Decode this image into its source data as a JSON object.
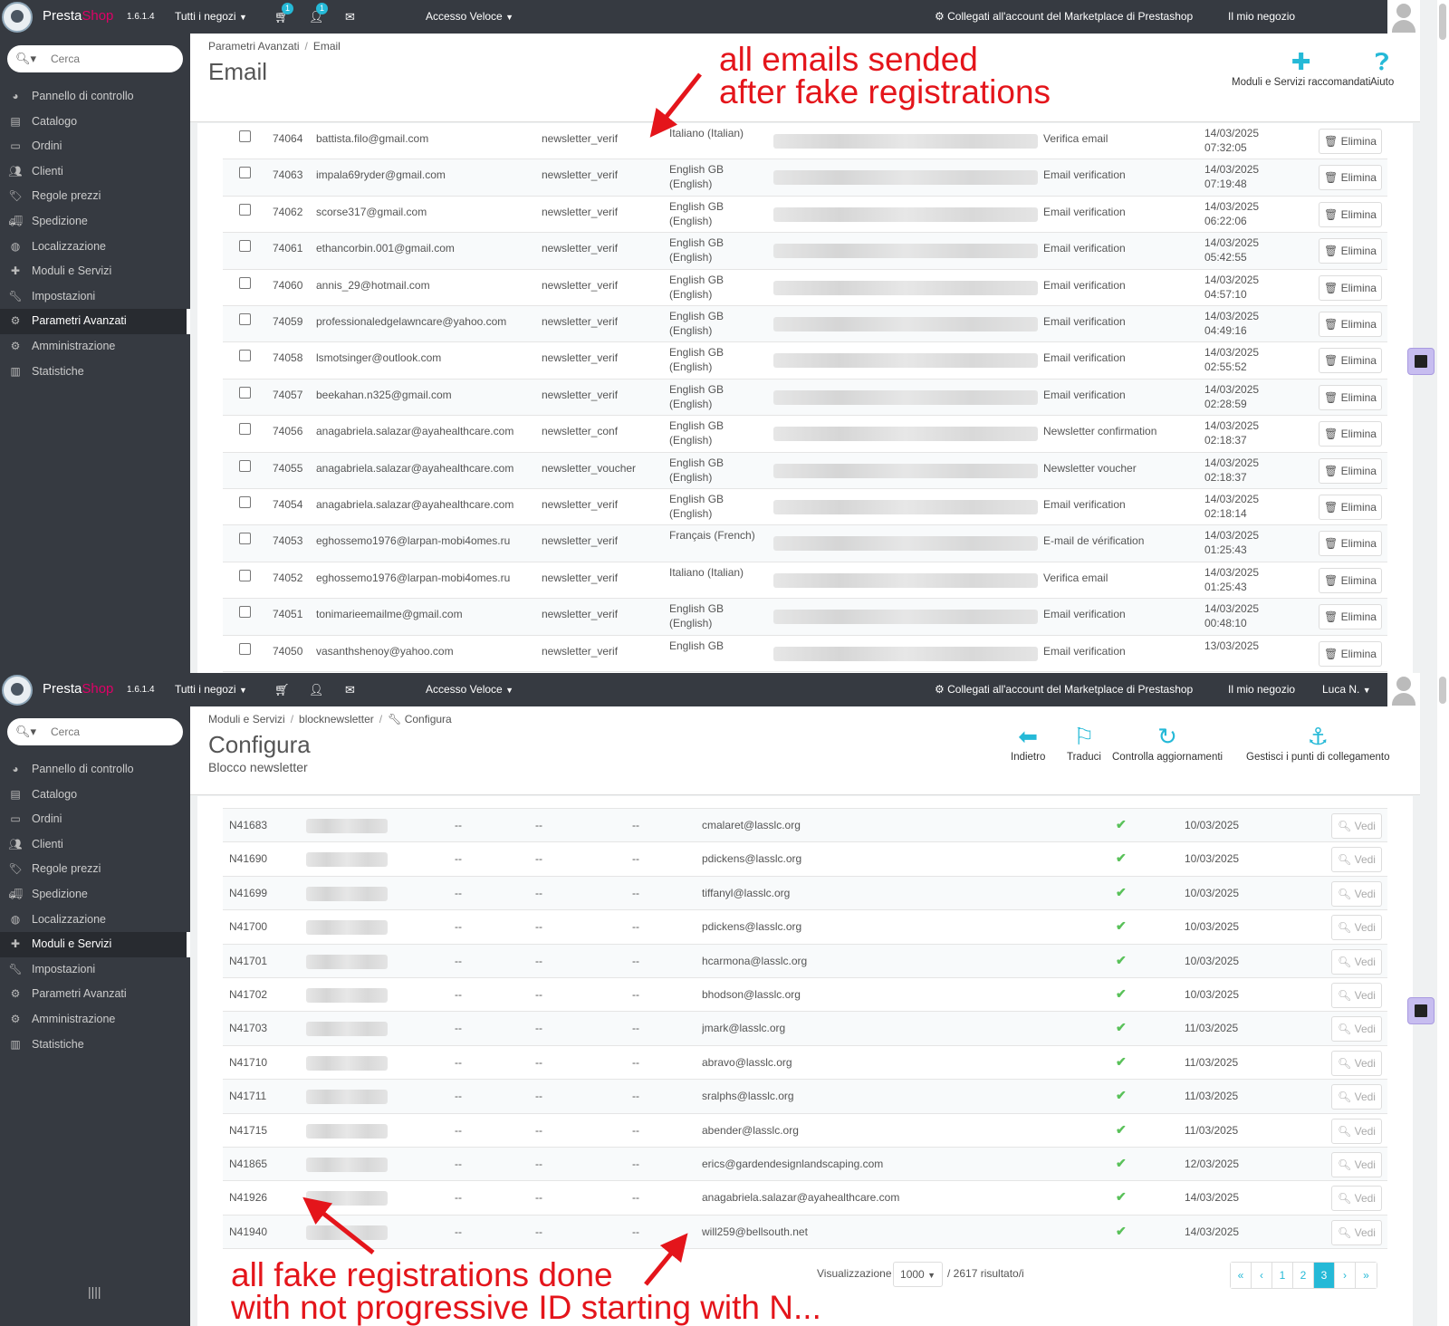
{
  "common": {
    "brand_a": "Presta",
    "brand_b": "Shop",
    "version": "1.6.1.4",
    "shops": "Tutti i negozi",
    "quick_access": "Accesso Veloce",
    "marketplace": "Collegati all'account del Marketplace di Prestashop",
    "my_shop": "Il mio negozio",
    "search_placeholder": "Cerca",
    "menu": [
      "Pannello di controllo",
      "Catalogo",
      "Ordini",
      "Clienti",
      "Regole prezzi",
      "Spedizione",
      "Localizzazione",
      "Moduli e Servizi",
      "Impostazioni",
      "Parametri Avanzati",
      "Amministrazione",
      "Statistiche"
    ],
    "accent": "#25b9d7",
    "sidebar_bg": "#363a41"
  },
  "panel1": {
    "cart_badge": "1",
    "customer_badge": "1",
    "breadcrumb": [
      "Parametri Avanzati",
      "Email"
    ],
    "title": "Email",
    "toolbar": [
      "Moduli e Servizi raccomandati",
      "Aiuto"
    ],
    "delete_label": "Elimina",
    "rows": [
      {
        "id": "74064",
        "email": "battista.filo@gmail.com",
        "template": "newsletter_verif",
        "lang1": "Italiano (Italian)",
        "lang2": "",
        "subject": "Verifica email",
        "date": "14/03/2025",
        "time": "07:32:05"
      },
      {
        "id": "74063",
        "email": "impala69ryder@gmail.com",
        "template": "newsletter_verif",
        "lang1": "English GB",
        "lang2": "(English)",
        "subject": "Email verification",
        "date": "14/03/2025",
        "time": "07:19:48"
      },
      {
        "id": "74062",
        "email": "scorse317@gmail.com",
        "template": "newsletter_verif",
        "lang1": "English GB",
        "lang2": "(English)",
        "subject": "Email verification",
        "date": "14/03/2025",
        "time": "06:22:06"
      },
      {
        "id": "74061",
        "email": "ethancorbin.001@gmail.com",
        "template": "newsletter_verif",
        "lang1": "English GB",
        "lang2": "(English)",
        "subject": "Email verification",
        "date": "14/03/2025",
        "time": "05:42:55"
      },
      {
        "id": "74060",
        "email": "annis_29@hotmail.com",
        "template": "newsletter_verif",
        "lang1": "English GB",
        "lang2": "(English)",
        "subject": "Email verification",
        "date": "14/03/2025",
        "time": "04:57:10"
      },
      {
        "id": "74059",
        "email": "professionaledgelawncare@yahoo.com",
        "template": "newsletter_verif",
        "lang1": "English GB",
        "lang2": "(English)",
        "subject": "Email verification",
        "date": "14/03/2025",
        "time": "04:49:16"
      },
      {
        "id": "74058",
        "email": "lsmotsinger@outlook.com",
        "template": "newsletter_verif",
        "lang1": "English GB",
        "lang2": "(English)",
        "subject": "Email verification",
        "date": "14/03/2025",
        "time": "02:55:52"
      },
      {
        "id": "74057",
        "email": "beekahan.n325@gmail.com",
        "template": "newsletter_verif",
        "lang1": "English GB",
        "lang2": "(English)",
        "subject": "Email verification",
        "date": "14/03/2025",
        "time": "02:28:59"
      },
      {
        "id": "74056",
        "email": "anagabriela.salazar@ayahealthcare.com",
        "template": "newsletter_conf",
        "lang1": "English GB",
        "lang2": "(English)",
        "subject": "Newsletter confirmation",
        "date": "14/03/2025",
        "time": "02:18:37"
      },
      {
        "id": "74055",
        "email": "anagabriela.salazar@ayahealthcare.com",
        "template": "newsletter_voucher",
        "lang1": "English GB",
        "lang2": "(English)",
        "subject": "Newsletter voucher",
        "date": "14/03/2025",
        "time": "02:18:37"
      },
      {
        "id": "74054",
        "email": "anagabriela.salazar@ayahealthcare.com",
        "template": "newsletter_verif",
        "lang1": "English GB",
        "lang2": "(English)",
        "subject": "Email verification",
        "date": "14/03/2025",
        "time": "02:18:14"
      },
      {
        "id": "74053",
        "email": "eghossemo1976@larpan-mobi4omes.ru",
        "template": "newsletter_verif",
        "lang1": "Français (French)",
        "lang2": "",
        "subject": "E-mail de vérification",
        "date": "14/03/2025",
        "time": "01:25:43"
      },
      {
        "id": "74052",
        "email": "eghossemo1976@larpan-mobi4omes.ru",
        "template": "newsletter_verif",
        "lang1": "Italiano (Italian)",
        "lang2": "",
        "subject": "Verifica email",
        "date": "14/03/2025",
        "time": "01:25:43"
      },
      {
        "id": "74051",
        "email": "tonimarieemailme@gmail.com",
        "template": "newsletter_verif",
        "lang1": "English GB",
        "lang2": "(English)",
        "subject": "Email verification",
        "date": "14/03/2025",
        "time": "00:48:10"
      },
      {
        "id": "74050",
        "email": "vasanthshenoy@yahoo.com",
        "template": "newsletter_verif",
        "lang1": "English GB",
        "lang2": "",
        "subject": "Email verification",
        "date": "13/03/2025",
        "time": ""
      }
    ],
    "annotation": [
      "all emails sended",
      "after fake registrations"
    ]
  },
  "panel2": {
    "user": "Luca N.",
    "breadcrumb": [
      "Moduli e Servizi",
      "blocknewsletter",
      "Configura"
    ],
    "title": "Configura",
    "subtitle": "Blocco newsletter",
    "toolbar": [
      "Indietro",
      "Traduci",
      "Controlla aggiornamenti",
      "Gestisci i punti di collegamento"
    ],
    "view_label": "Vedi",
    "dash": "--",
    "rows": [
      {
        "id": "N41683",
        "email": "cmalaret@lasslc.org",
        "date": "10/03/2025"
      },
      {
        "id": "N41690",
        "email": "pdickens@lasslc.org",
        "date": "10/03/2025"
      },
      {
        "id": "N41699",
        "email": "tiffanyl@lasslc.org",
        "date": "10/03/2025"
      },
      {
        "id": "N41700",
        "email": "pdickens@lasslc.org",
        "date": "10/03/2025"
      },
      {
        "id": "N41701",
        "email": "hcarmona@lasslc.org",
        "date": "10/03/2025"
      },
      {
        "id": "N41702",
        "email": "bhodson@lasslc.org",
        "date": "10/03/2025"
      },
      {
        "id": "N41703",
        "email": "jmark@lasslc.org",
        "date": "11/03/2025"
      },
      {
        "id": "N41710",
        "email": "abravo@lasslc.org",
        "date": "11/03/2025"
      },
      {
        "id": "N41711",
        "email": "sralphs@lasslc.org",
        "date": "11/03/2025"
      },
      {
        "id": "N41715",
        "email": "abender@lasslc.org",
        "date": "11/03/2025"
      },
      {
        "id": "N41865",
        "email": "erics@gardendesignlandscaping.com",
        "date": "12/03/2025"
      },
      {
        "id": "N41926",
        "email": "anagabriela.salazar@ayahealthcare.com",
        "date": "14/03/2025"
      },
      {
        "id": "N41940",
        "email": "will259@bellsouth.net",
        "date": "14/03/2025"
      }
    ],
    "pagination_label": "Visualizzazione",
    "per_page": "1000",
    "results": "/ 2617 risultato/i",
    "pages": [
      "«",
      "‹",
      "1",
      "2",
      "3",
      "›",
      "»"
    ],
    "current_page": "3",
    "annotation": [
      "all fake registrations done",
      "with not progressive ID starting with N..."
    ]
  }
}
